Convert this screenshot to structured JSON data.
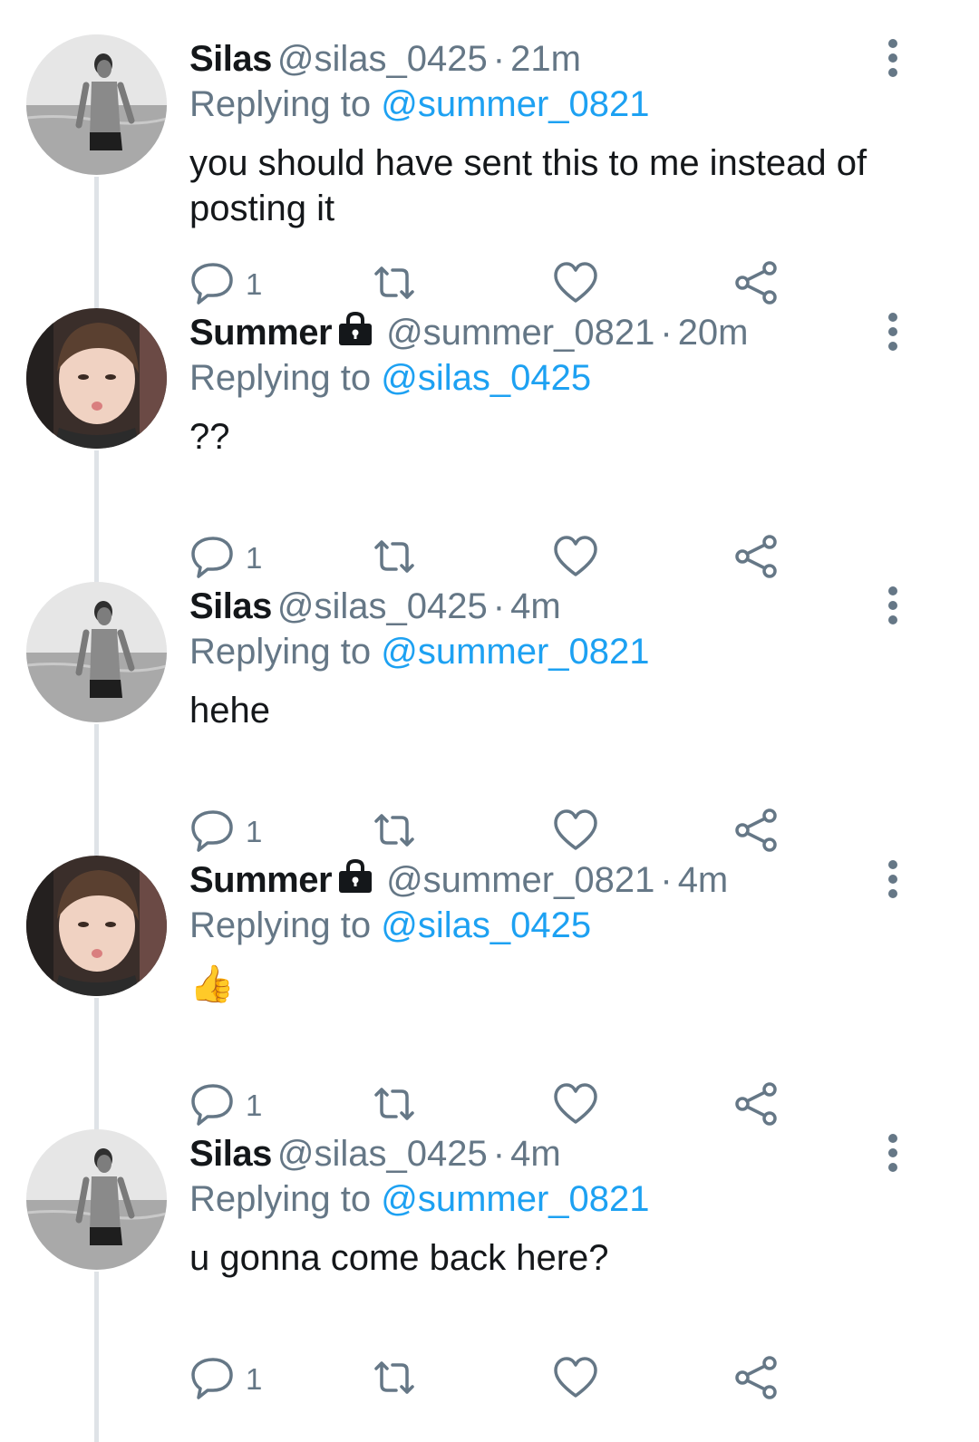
{
  "tweets": [
    {
      "name": "Silas",
      "locked": false,
      "handle": "@silas_0425",
      "time": "21m",
      "replying_prefix": "Replying to",
      "replying_handle": "@summer_0821",
      "text": "you should have sent this to me instead of posting it",
      "reply_count": "1",
      "avatar": "silas-beach-avatar"
    },
    {
      "name": "Summer",
      "locked": true,
      "handle": "@summer_0821",
      "time": "20m",
      "replying_prefix": "Replying to",
      "replying_handle": "@silas_0425",
      "text": "??",
      "reply_count": "1",
      "avatar": "summer-portrait-avatar"
    },
    {
      "name": "Silas",
      "locked": false,
      "handle": "@silas_0425",
      "time": "4m",
      "replying_prefix": "Replying to",
      "replying_handle": "@summer_0821",
      "text": "hehe",
      "reply_count": "1",
      "avatar": "silas-beach-avatar"
    },
    {
      "name": "Summer",
      "locked": true,
      "handle": "@summer_0821",
      "time": "4m",
      "replying_prefix": "Replying to",
      "replying_handle": "@silas_0425",
      "text": "👍",
      "reply_count": "1",
      "avatar": "summer-portrait-avatar"
    },
    {
      "name": "Silas",
      "locked": false,
      "handle": "@silas_0425",
      "time": "4m",
      "replying_prefix": "Replying to",
      "replying_handle": "@summer_0821",
      "text": "u gonna come back here?",
      "reply_count": "1",
      "avatar": "silas-beach-avatar"
    }
  ],
  "separator": "·",
  "colors": {
    "link": "#1da1f2",
    "secondary_text": "#657786",
    "primary_text": "#14171a",
    "thread_line": "#dfe3e7"
  },
  "icons": {
    "reply": "reply-icon",
    "retweet": "retweet-icon",
    "like": "heart-icon",
    "share": "share-icon",
    "more": "more-vertical-icon",
    "protected": "lock-icon"
  }
}
